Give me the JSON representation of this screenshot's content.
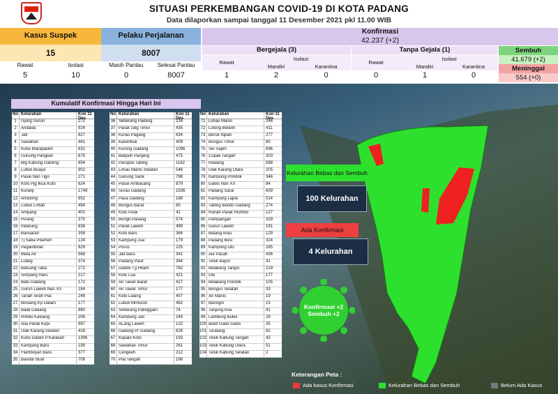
{
  "header": {
    "title": "SITUASI PERKEMBANGAN COVID-19 DI KOTA PADANG",
    "subtitle": "Data dilaporkan sampai tanggal 11 Desember 2021 pkl 11.00 WIB"
  },
  "stats": {
    "suspek": {
      "label": "Kasus Suspek",
      "value": "15",
      "rawat_label": "Rawat",
      "rawat": "5",
      "isolasi_label": "Isolasi",
      "isolasi": "10"
    },
    "pelaku": {
      "label": "Pelaku Perjalanan",
      "value": "8007",
      "pantau_label": "Masih Pantau",
      "pantau": "0",
      "selesai_label": "Selesai Pantau",
      "selesai": "8007"
    },
    "konfirmasi": {
      "label": "Konfirmasi",
      "value": "42.237 (+2)"
    },
    "bergejala": {
      "label": "Bergejala (3)",
      "rawat_label": "Rawat",
      "rawat": "1",
      "isolasi_label": "Isolasi",
      "mandiri_label": "Mandiri",
      "mandiri": "2",
      "karantina_label": "Karantina",
      "karantina": "0"
    },
    "tanpa_gejala": {
      "label": "Tanpa Gejala (1)",
      "rawat_label": "Rawat",
      "rawat": "0",
      "isolasi_label": "Isolasi",
      "mandiri_label": "Mandiri",
      "mandiri": "1",
      "karantina_label": "Karantina",
      "karantina": "0"
    },
    "sembuh": {
      "label": "Sembuh",
      "value": "41.679 (+2)"
    },
    "meninggal": {
      "label": "Meninggal",
      "value": "554 (+0)"
    }
  },
  "colors": {
    "orange": "#f6b73a",
    "blue": "#8ab2dd",
    "purple": "#d9c6ec",
    "lightorange": "#fde6b4",
    "green": "#2ee02e",
    "red": "#ee3a3a"
  },
  "map_panel": {
    "title": "Kumulatif Konfirmasi Hingga Hari Ini",
    "col_no": "No",
    "col_kel": "Kelurahan",
    "col_kon": "Kon 11 Des",
    "bebas_label": "Kelurahan Bebas dan Sembuh",
    "bebas_value": "100 Kelurahan",
    "ada_label": "Ada Konfirmasi",
    "ada_value": "4 Kelurahan",
    "virus_text": "Konfirmasi +2 Sembuh +2",
    "legend_title": "Keterangan Peta :",
    "legend": [
      "Ada kasus Konfirmasi",
      "Kelurahan Bebas dan Sembuh",
      "Belum Ada Kasus"
    ],
    "table1": [
      [
        "1",
        "Ujung Gurun",
        "272"
      ],
      [
        "2",
        "Andalas",
        "924"
      ],
      [
        "3",
        "Jati",
        "927"
      ],
      [
        "4",
        "Sawahan",
        "441"
      ],
      [
        "5",
        "Kubu Marapalam",
        "632"
      ],
      [
        "6",
        "Gunung Pangilun",
        "675"
      ],
      [
        "7",
        "Btg Kabung Ganting",
        "654"
      ],
      [
        "8",
        "Lubuk Buaya",
        "902"
      ],
      [
        "9",
        "Pasie Nan Tigo",
        "271"
      ],
      [
        "10",
        "Koto Pjg Ikua Koto",
        "624"
      ],
      [
        "11",
        "Kuranji",
        "1749"
      ],
      [
        "12",
        "Anduring",
        "652"
      ],
      [
        "13",
        "Lubuk Lintah",
        "494"
      ],
      [
        "14",
        "Ampang",
        "401"
      ],
      [
        "15",
        "Pisang",
        "375"
      ],
      [
        "16",
        "Indarung",
        "838"
      ],
      [
        "17",
        "Banuaran",
        "358"
      ],
      [
        "18",
        "Tj Saba Pitameh",
        "134"
      ],
      [
        "19",
        "Pegambiran",
        "929"
      ],
      [
        "20",
        "Mata Air",
        "568"
      ],
      [
        "21",
        "Lubeg",
        "374"
      ],
      [
        "22",
        "Batuang Taba",
        "272"
      ],
      [
        "23",
        "Simpang Haru",
        "217"
      ],
      [
        "24",
        "Batu Gadang",
        "172"
      ],
      [
        "25",
        "Gurun Laweh Nan XX",
        "184"
      ],
      [
        "26",
        "Tanah Sirah Piai",
        "248"
      ],
      [
        "27",
        "Binuang Kp Dalam",
        "177"
      ],
      [
        "28",
        "Balai Gadang",
        "860"
      ],
      [
        "29",
        "Rimbo Kaluang",
        "206"
      ],
      [
        "30",
        "Alai Parak Kopi",
        "997"
      ],
      [
        "31",
        "Ulak Karang Selatan",
        "418"
      ],
      [
        "32",
        "Kubu Dalam P.Karakah",
        "1306"
      ],
      [
        "33",
        "Kampung Baru",
        "199"
      ],
      [
        "34",
        "Flamboyan Baru",
        "377"
      ],
      [
        "35",
        "Bandar Buat",
        "709"
      ]
    ],
    "table2": [
      [
        "36",
        "Seberang Padang",
        "216"
      ],
      [
        "37",
        "Parak Gdg Timur",
        "435"
      ],
      [
        "38",
        "Kurao Pagang",
        "634"
      ],
      [
        "39",
        "Kalumbuk",
        "409"
      ],
      [
        "40",
        "Korong Gadang",
        "1096"
      ],
      [
        "41",
        "Batipuh Panjang",
        "475"
      ],
      [
        "42",
        "Parupuk Tabing",
        "1182"
      ],
      [
        "43",
        "Limau Manis Selatan",
        "546"
      ],
      [
        "44",
        "Gunung Sarik",
        "798"
      ],
      [
        "45",
        "Pasar Ambacang",
        "879"
      ],
      [
        "46",
        "Surau Gadang",
        "1536"
      ],
      [
        "47",
        "Pasa Gadang",
        "188"
      ],
      [
        "48",
        "Bungus Barat",
        "85"
      ],
      [
        "49",
        "Koto Pulai",
        "41"
      ],
      [
        "50",
        "Bungo Pasang",
        "574"
      ],
      [
        "51",
        "Parak Laweh",
        "499"
      ],
      [
        "52",
        "Koto Baru",
        "364"
      ],
      [
        "53",
        "Kampung Jua",
        "179"
      ],
      [
        "54",
        "Purus",
        "225"
      ],
      [
        "55",
        "Jati Baru",
        "341"
      ],
      [
        "56",
        "Padang Pasir",
        "364"
      ],
      [
        "57",
        "Dadok Tg Hitam",
        "782"
      ],
      [
        "58",
        "Koto Lua",
        "421"
      ],
      [
        "59",
        "Air Tawar Barat",
        "427"
      ],
      [
        "60",
        "Air Tawar Timur",
        "177"
      ],
      [
        "61",
        "Koto Lalang",
        "407"
      ],
      [
        "62",
        "Lubuk Minturun",
        "462"
      ],
      [
        "63",
        "Seberang Palinggam",
        "74"
      ],
      [
        "64",
        "Kampung Jao",
        "249"
      ],
      [
        "65",
        "ALang Laweh",
        "132"
      ],
      [
        "66",
        "Gadang Pr Gadang",
        "626"
      ],
      [
        "67",
        "Kapalo Koto",
        "193"
      ],
      [
        "68",
        "Sawahan Timur",
        "261"
      ],
      [
        "69",
        "Cengkeh",
        "212"
      ],
      [
        "70",
        "Piai Tangah",
        "198"
      ]
    ],
    "table3": [
      [
        "71",
        "Limau Manis",
        "246"
      ],
      [
        "72",
        "Lolong Belanti",
        "411"
      ],
      [
        "73",
        "Berok Nipah",
        "277"
      ],
      [
        "74",
        "Bungus Timur",
        "60"
      ],
      [
        "75",
        "Sei Sapih",
        "696"
      ],
      [
        "76",
        "Cupak Tangah",
        "303"
      ],
      [
        "77",
        "Rawang",
        "588"
      ],
      [
        "78",
        "Ulak Karang Utara",
        "205"
      ],
      [
        "79",
        "Kampung Pondok",
        "346"
      ],
      [
        "80",
        "Gates Nan XX",
        "84"
      ],
      [
        "81",
        "Padang Sarai",
        "609"
      ],
      [
        "82",
        "Kampung Lapai",
        "514"
      ],
      [
        "83",
        "Tabing Bando Gadang",
        "274"
      ],
      [
        "84",
        "Ranah Parak Rumbio",
        "127"
      ],
      [
        "85",
        "Pampangan",
        "329"
      ],
      [
        "86",
        "Gurun Laweh",
        "191"
      ],
      [
        "87",
        "Batang Arau",
        "129"
      ],
      [
        "88",
        "Padang Besi",
        "324"
      ],
      [
        "89",
        "Kampung Olo",
        "285"
      ],
      [
        "90",
        "Aie Pacah",
        "436"
      ],
      [
        "91",
        "Teluk Bayur",
        "41"
      ],
      [
        "92",
        "Belakang Tangsi",
        "219"
      ],
      [
        "93",
        "Olo",
        "177"
      ],
      [
        "94",
        "Belakang Pondok",
        "105"
      ],
      [
        "95",
        "Bungus Selatan",
        "33"
      ],
      [
        "96",
        "Air Manis",
        "19"
      ],
      [
        "97",
        "Baringin",
        "15"
      ],
      [
        "98",
        "Tanjung Aua",
        "41"
      ],
      [
        "99",
        "Lambung Bukik",
        "28"
      ],
      [
        "100",
        "Bukit Gado Gado",
        "35"
      ],
      [
        "101",
        "Taratang",
        "62"
      ],
      [
        "102",
        "Teluk Kabung Tengah",
        "43"
      ],
      [
        "103",
        "Teluk Kabung Utara",
        "51"
      ],
      [
        "104",
        "Teluk Kabung Selatan",
        "2"
      ]
    ]
  }
}
